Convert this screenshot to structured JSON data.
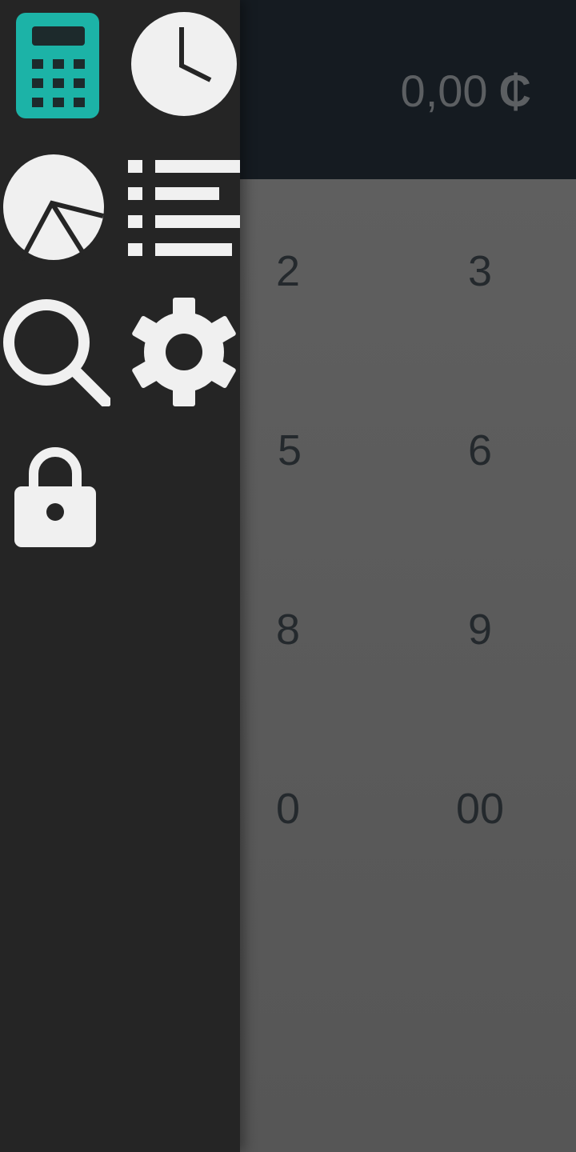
{
  "display": {
    "amount": "0,00",
    "currency_symbol": "₵"
  },
  "keypad": {
    "keys": [
      "2",
      "3",
      "5",
      "6",
      "8",
      "9",
      "0",
      "00"
    ]
  },
  "drawer": {
    "items": [
      {
        "icon": "calculator-icon",
        "active": true
      },
      {
        "icon": "clock-icon",
        "active": false
      },
      {
        "icon": "pie-chart-icon",
        "active": false
      },
      {
        "icon": "list-icon",
        "active": false
      },
      {
        "icon": "search-icon",
        "active": false
      },
      {
        "icon": "gear-icon",
        "active": false
      },
      {
        "icon": "lock-icon",
        "active": false
      }
    ]
  },
  "colors": {
    "accent": "#1cb3a7",
    "icon": "#f0f0f0",
    "drawer_bg": "#252525",
    "display_bg": "#151b21",
    "keypad_bg": "#5d5d5d"
  }
}
